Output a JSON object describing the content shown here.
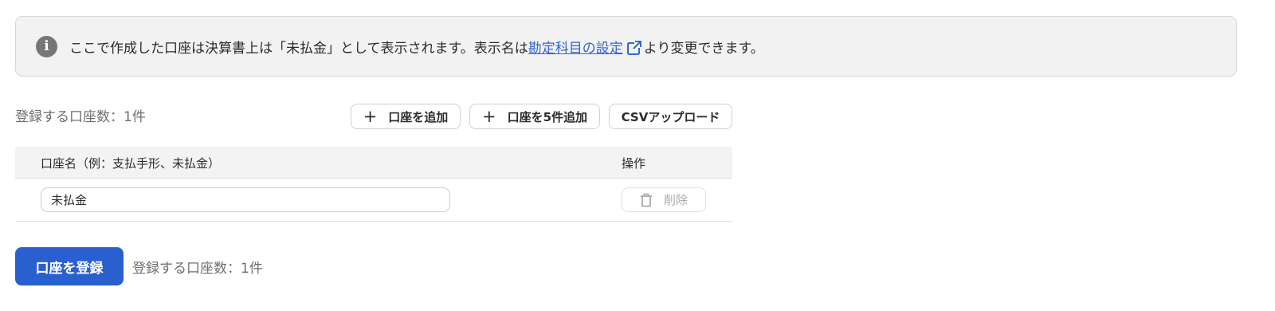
{
  "notice": {
    "icon": "info-icon",
    "icon_glyph": "i",
    "text_before": "ここで作成した口座は決算書上は「未払金」として表示されます。表示名は",
    "link_text": "勘定科目の設定",
    "link_icon": "external-link-icon",
    "text_after": "より変更できます。"
  },
  "summary": {
    "count_label": "登録する口座数：1件"
  },
  "actions": {
    "add_label": "口座を追加",
    "add_five_label": "口座を5件追加",
    "csv_upload_label": "CSVアップロード",
    "plus_glyph": "+"
  },
  "table": {
    "columns": {
      "name": "口座名（例：支払手形、未払金）",
      "operation": "操作"
    },
    "rows": [
      {
        "name_value": "未払金",
        "delete_label": "削除"
      }
    ]
  },
  "footer": {
    "register_label": "口座を登録",
    "count_label": "登録する口座数：1件"
  },
  "colors": {
    "primary": "#2a5fcf",
    "link": "#2f66d0",
    "notice_bg": "#f3f2f2"
  }
}
